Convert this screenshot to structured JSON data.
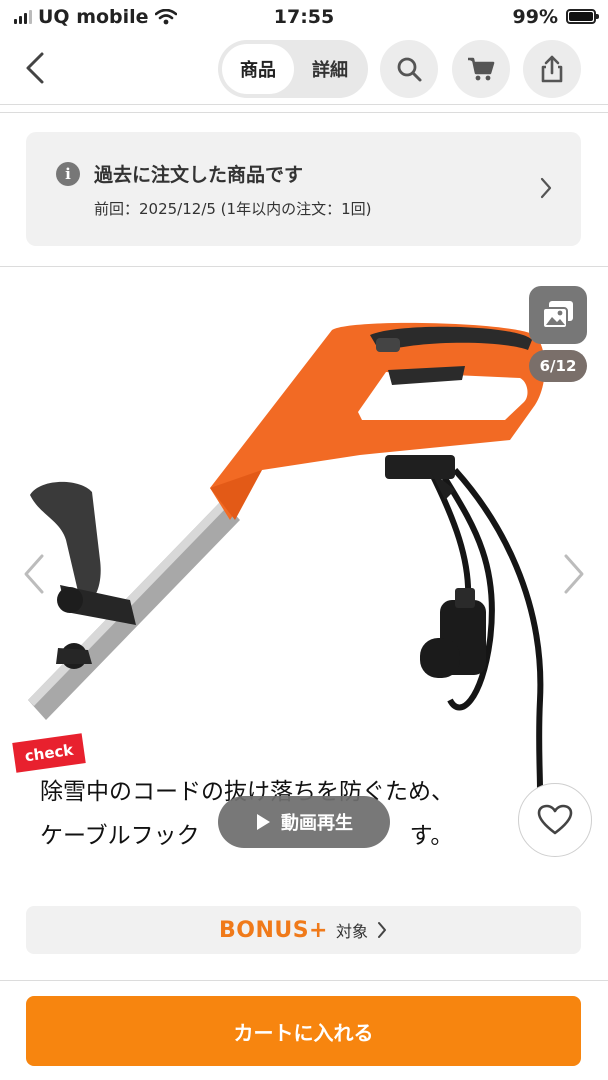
{
  "status_bar": {
    "carrier": "UQ mobile",
    "time": "17:55",
    "battery": "99%"
  },
  "header": {
    "tabs": [
      {
        "label": "商品",
        "active": true
      },
      {
        "label": "詳細",
        "active": false
      }
    ],
    "icons": [
      "back-icon",
      "search-icon",
      "cart-icon",
      "share-icon"
    ]
  },
  "order_notice": {
    "title": "過去に注文した商品です",
    "detail": "前回：2025/12/5 (1年以内の注文：1回)"
  },
  "gallery": {
    "counter": "6/12",
    "tag": "check",
    "caption_line1": "除雪中のコードの抜け落ちを防ぐため、",
    "caption_line2": "ケーブルフック",
    "caption_line2_end": "す。",
    "video_label": "動画再生"
  },
  "bonus": {
    "brand": "BONUS+",
    "label": "対象"
  },
  "cart_button": "カートに入れる",
  "colors": {
    "accent": "#f7850f",
    "bonus": "#f07a1a",
    "check_tag": "#e8212e",
    "product_orange": "#f26a24"
  }
}
